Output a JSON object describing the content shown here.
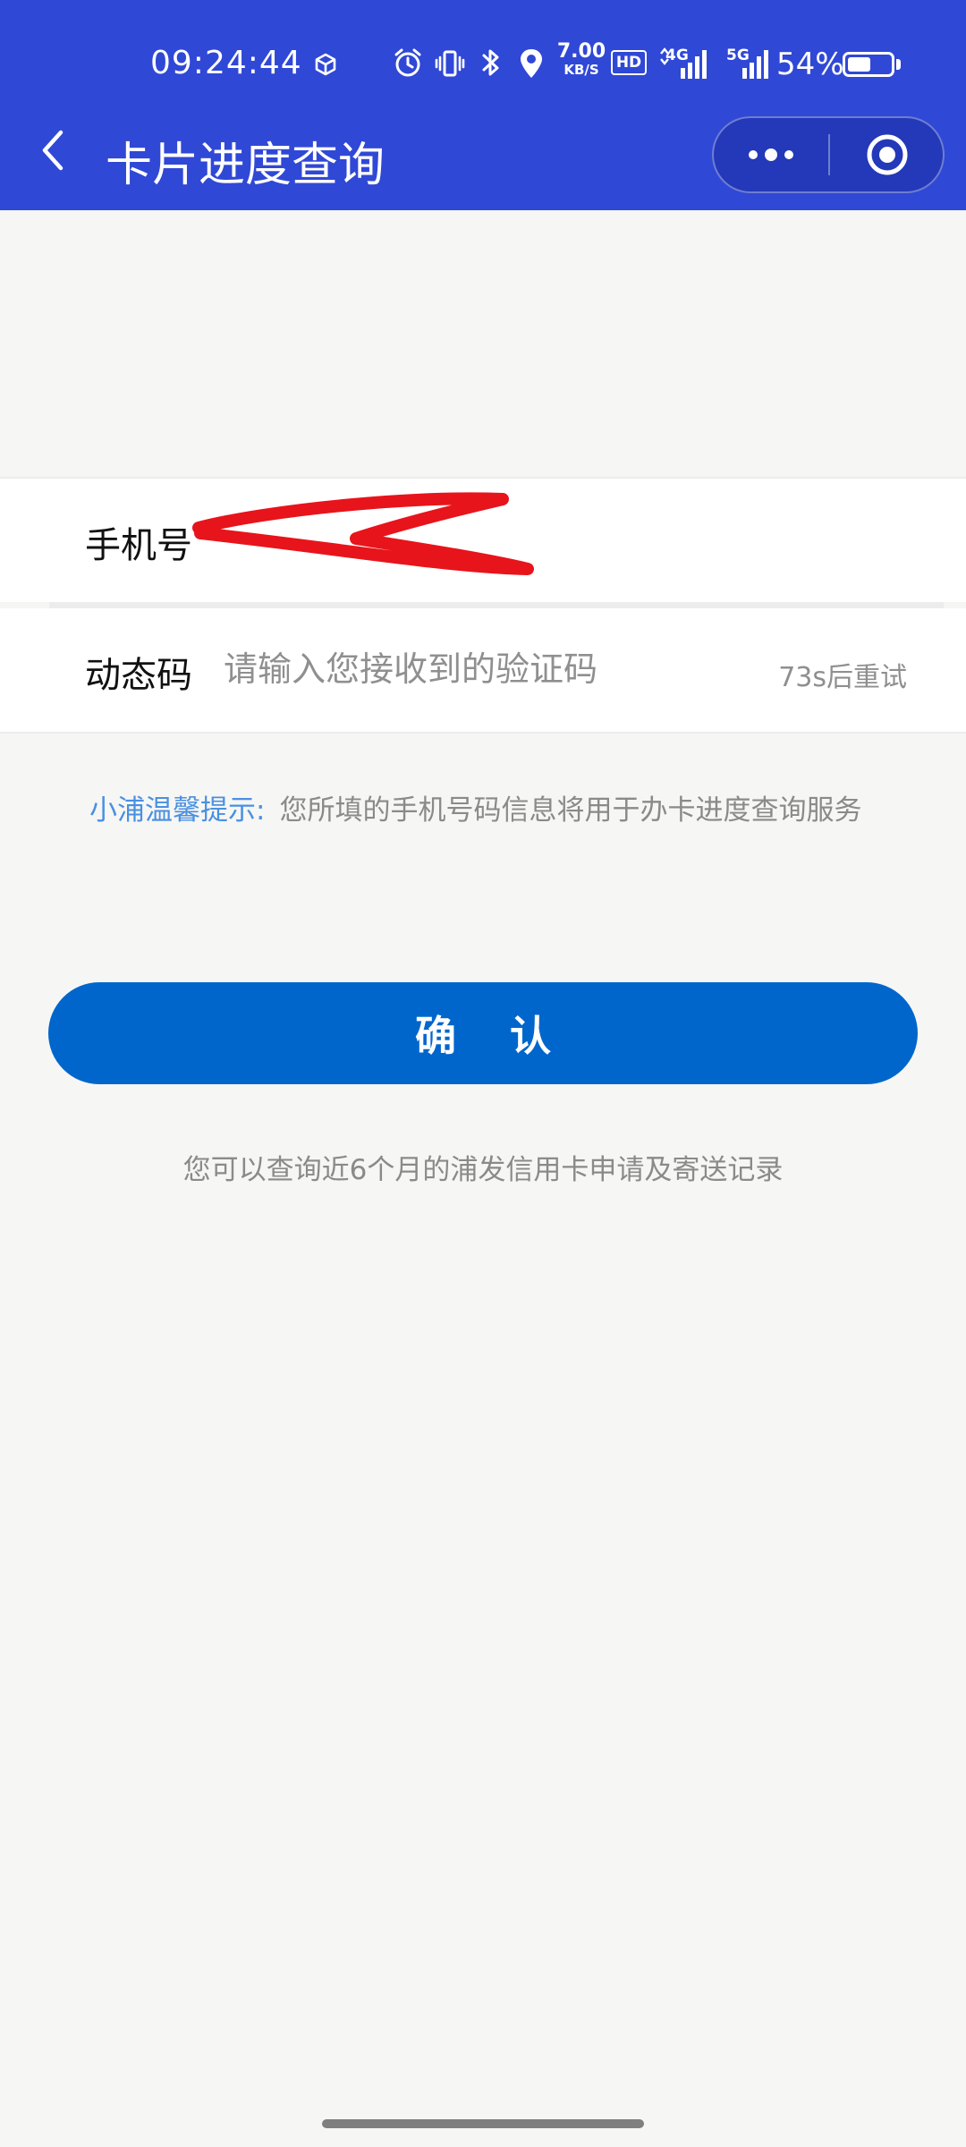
{
  "status_bar": {
    "time": "09:24:44",
    "net_speed_value": "7.00",
    "net_speed_unit": "KB/S",
    "hd_label": "HD",
    "network_1": "4G",
    "network_2": "5G",
    "battery_percent": "54%",
    "battery_level": 0.54
  },
  "nav": {
    "title": "卡片进度查询"
  },
  "form": {
    "phone_label": "手机号",
    "phone_value": "",
    "code_label": "动态码",
    "code_placeholder": "请输入您接收到的验证码",
    "retry_label": "73s后重试"
  },
  "tip": {
    "label": "小浦温馨提示:",
    "text": "您所填的手机号码信息将用于办卡进度查询服务"
  },
  "confirm_label": "确 认",
  "hint": "您可以查询近6个月的浦发信用卡申请及寄送记录",
  "colors": {
    "header": "#3048d6",
    "primary_button": "#0066cc",
    "tip_label": "#4a90e2",
    "redaction": "#e8141b"
  }
}
